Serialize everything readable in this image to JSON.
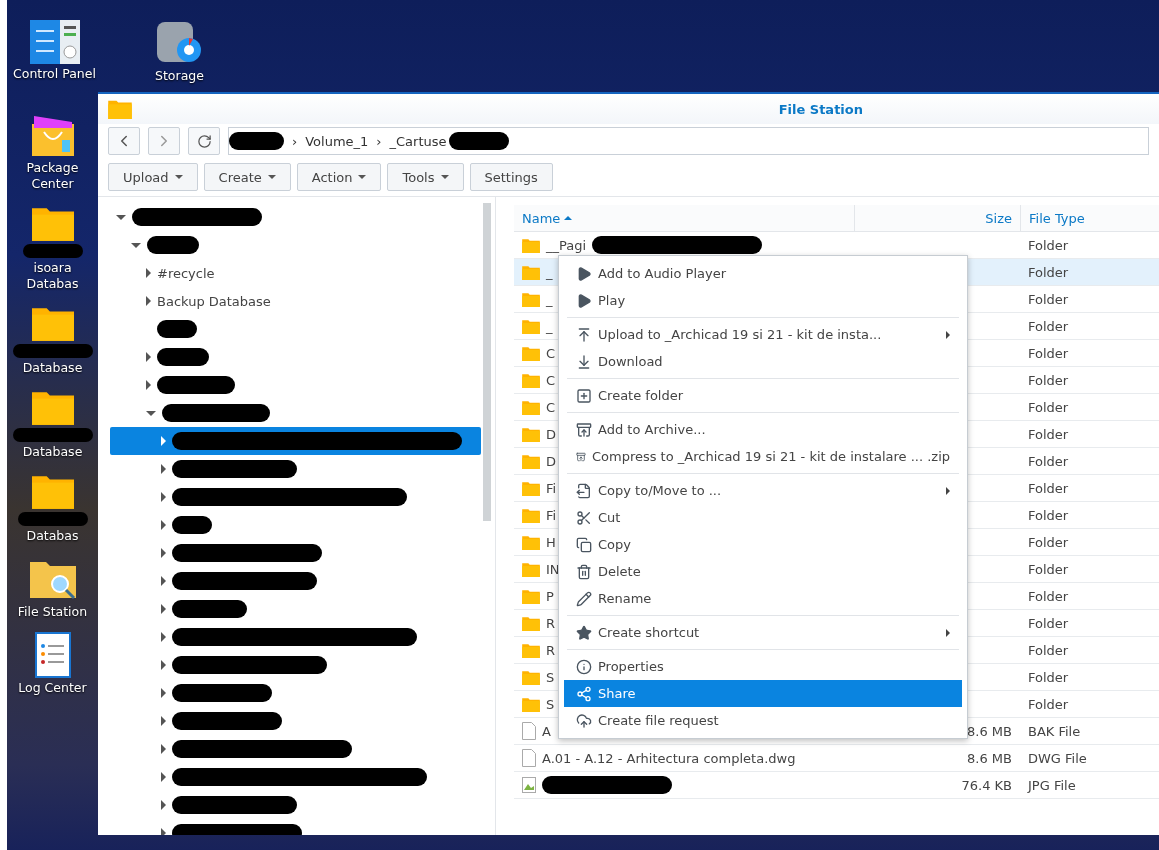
{
  "desktop_icons": [
    {
      "label": "Control Panel",
      "kind": "control"
    },
    {
      "label": "Storage",
      "kind": "storage"
    },
    {
      "label": "Package Center",
      "kind": "package"
    },
    {
      "label": "isoara Databas",
      "kind": "folder",
      "redacted": true
    },
    {
      "label": "Database",
      "kind": "folder",
      "redacted": true
    },
    {
      "label": "Database",
      "kind": "folder",
      "redacted": true
    },
    {
      "label": "Databas",
      "kind": "folder",
      "redacted": true
    },
    {
      "label": "File Station",
      "kind": "filestation"
    },
    {
      "label": "Log Center",
      "kind": "log"
    }
  ],
  "window": {
    "title": "File Station"
  },
  "path": {
    "segments": [
      {
        "redacted": true
      },
      {
        "label": "Volume_1"
      },
      {
        "label": "_Cartuse",
        "redacted": true
      }
    ],
    "separator": "›"
  },
  "toolbar": [
    {
      "label": "Upload",
      "dropdown": true
    },
    {
      "label": "Create",
      "dropdown": true
    },
    {
      "label": "Action",
      "dropdown": true
    },
    {
      "label": "Tools",
      "dropdown": true
    },
    {
      "label": "Settings",
      "dropdown": false
    }
  ],
  "tree": [
    {
      "redacted": true,
      "expanded": true,
      "selected": false,
      "children": [
        {
          "redacted": true,
          "expanded": true,
          "selected": false,
          "children": [
            {
              "label": "#recycle",
              "expanded": false,
              "selected": false
            },
            {
              "label": "Backup Database",
              "expanded": false,
              "selected": false
            },
            {
              "redacted": true,
              "expanded": false,
              "selected": false,
              "leaf": true
            },
            {
              "redacted": true,
              "expanded": false,
              "selected": false
            },
            {
              "redacted": true,
              "expanded": false,
              "selected": false
            },
            {
              "redacted": true,
              "expanded": true,
              "selected": false,
              "children": [
                {
                  "redacted": true,
                  "expanded": false,
                  "selected": true
                },
                {
                  "redacted": true,
                  "expanded": false,
                  "selected": false
                },
                {
                  "redacted": true,
                  "expanded": false,
                  "selected": false
                },
                {
                  "redacted": true,
                  "expanded": false,
                  "selected": false
                },
                {
                  "redacted": true,
                  "expanded": false,
                  "selected": false
                },
                {
                  "redacted": true,
                  "expanded": false,
                  "selected": false
                },
                {
                  "redacted": true,
                  "expanded": false,
                  "selected": false
                },
                {
                  "redacted": true,
                  "expanded": false,
                  "selected": false
                },
                {
                  "redacted": true,
                  "expanded": false,
                  "selected": false
                },
                {
                  "redacted": true,
                  "expanded": false,
                  "selected": false
                },
                {
                  "redacted": true,
                  "expanded": false,
                  "selected": false
                },
                {
                  "redacted": true,
                  "expanded": false,
                  "selected": false
                },
                {
                  "redacted": true,
                  "expanded": false,
                  "selected": false
                },
                {
                  "redacted": true,
                  "expanded": false,
                  "selected": false
                },
                {
                  "redacted": true,
                  "expanded": false,
                  "selected": false
                }
              ]
            }
          ]
        }
      ]
    }
  ],
  "table": {
    "columns": [
      {
        "label": "Name",
        "sorted": true
      },
      {
        "label": "Size",
        "sorted": false
      },
      {
        "label": "File Type",
        "sorted": false
      }
    ],
    "rows": [
      {
        "kind": "folder",
        "name": "__Pagi",
        "redacted": true,
        "size": "",
        "type": "Folder",
        "selected": false
      },
      {
        "kind": "folder",
        "name": "_",
        "size": "",
        "type": "Folder",
        "selected": true
      },
      {
        "kind": "folder",
        "name": "_",
        "size": "",
        "type": "Folder",
        "selected": false
      },
      {
        "kind": "folder",
        "name": "_",
        "size": "",
        "type": "Folder",
        "selected": false
      },
      {
        "kind": "folder",
        "name": "C",
        "size": "",
        "type": "Folder",
        "selected": false
      },
      {
        "kind": "folder",
        "name": "C",
        "size": "",
        "type": "Folder",
        "selected": false
      },
      {
        "kind": "folder",
        "name": "C",
        "size": "",
        "type": "Folder",
        "selected": false
      },
      {
        "kind": "folder",
        "name": "D",
        "size": "",
        "type": "Folder",
        "selected": false
      },
      {
        "kind": "folder",
        "name": "D",
        "size": "",
        "type": "Folder",
        "selected": false
      },
      {
        "kind": "folder",
        "name": "Fi",
        "size": "",
        "type": "Folder",
        "selected": false
      },
      {
        "kind": "folder",
        "name": "Fi",
        "size": "",
        "type": "Folder",
        "selected": false
      },
      {
        "kind": "folder",
        "name": "H",
        "size": "",
        "type": "Folder",
        "selected": false
      },
      {
        "kind": "folder",
        "name": "IN",
        "size": "",
        "type": "Folder",
        "selected": false
      },
      {
        "kind": "folder",
        "name": "P",
        "size": "",
        "type": "Folder",
        "selected": false
      },
      {
        "kind": "folder",
        "name": "R",
        "size": "",
        "type": "Folder",
        "selected": false
      },
      {
        "kind": "folder",
        "name": "R",
        "size": "",
        "type": "Folder",
        "selected": false
      },
      {
        "kind": "folder",
        "name": "S",
        "size": "",
        "type": "Folder",
        "selected": false
      },
      {
        "kind": "folder",
        "name": "S",
        "size": "",
        "type": "Folder",
        "selected": false
      },
      {
        "kind": "file",
        "name": "A",
        "size": "8.6 MB",
        "type": "BAK File",
        "selected": false
      },
      {
        "kind": "file",
        "name": "A.01 - A.12 - Arhitectura completa.dwg",
        "size": "8.6 MB",
        "type": "DWG File",
        "selected": false
      },
      {
        "kind": "image",
        "name": "",
        "redacted": true,
        "size": "76.4 KB",
        "type": "JPG File",
        "selected": false
      }
    ]
  },
  "context_menu": {
    "groups": [
      [
        {
          "label": "Add to Audio Player",
          "submenu": false,
          "selected": false
        },
        {
          "label": "Play",
          "submenu": false,
          "selected": false
        }
      ],
      [
        {
          "label": "Upload to _Archicad 19 si 21 - kit de insta...",
          "submenu": true,
          "selected": false
        },
        {
          "label": "Download",
          "submenu": false,
          "selected": false
        }
      ],
      [
        {
          "label": "Create folder",
          "submenu": false,
          "selected": false
        }
      ],
      [
        {
          "label": "Add to Archive...",
          "submenu": false,
          "selected": false
        },
        {
          "label": "Compress to _Archicad 19 si 21 - kit de instalare ... .zip",
          "submenu": false,
          "selected": false
        }
      ],
      [
        {
          "label": "Copy to/Move to ...",
          "submenu": true,
          "selected": false
        },
        {
          "label": "Cut",
          "submenu": false,
          "selected": false
        },
        {
          "label": "Copy",
          "submenu": false,
          "selected": false
        },
        {
          "label": "Delete",
          "submenu": false,
          "selected": false
        },
        {
          "label": "Rename",
          "submenu": false,
          "selected": false
        }
      ],
      [
        {
          "label": "Create shortcut",
          "submenu": true,
          "selected": false
        }
      ],
      [
        {
          "label": "Properties",
          "submenu": false,
          "selected": false
        },
        {
          "label": "Share",
          "submenu": false,
          "selected": true
        },
        {
          "label": "Create file request",
          "submenu": false,
          "selected": false
        }
      ]
    ]
  }
}
